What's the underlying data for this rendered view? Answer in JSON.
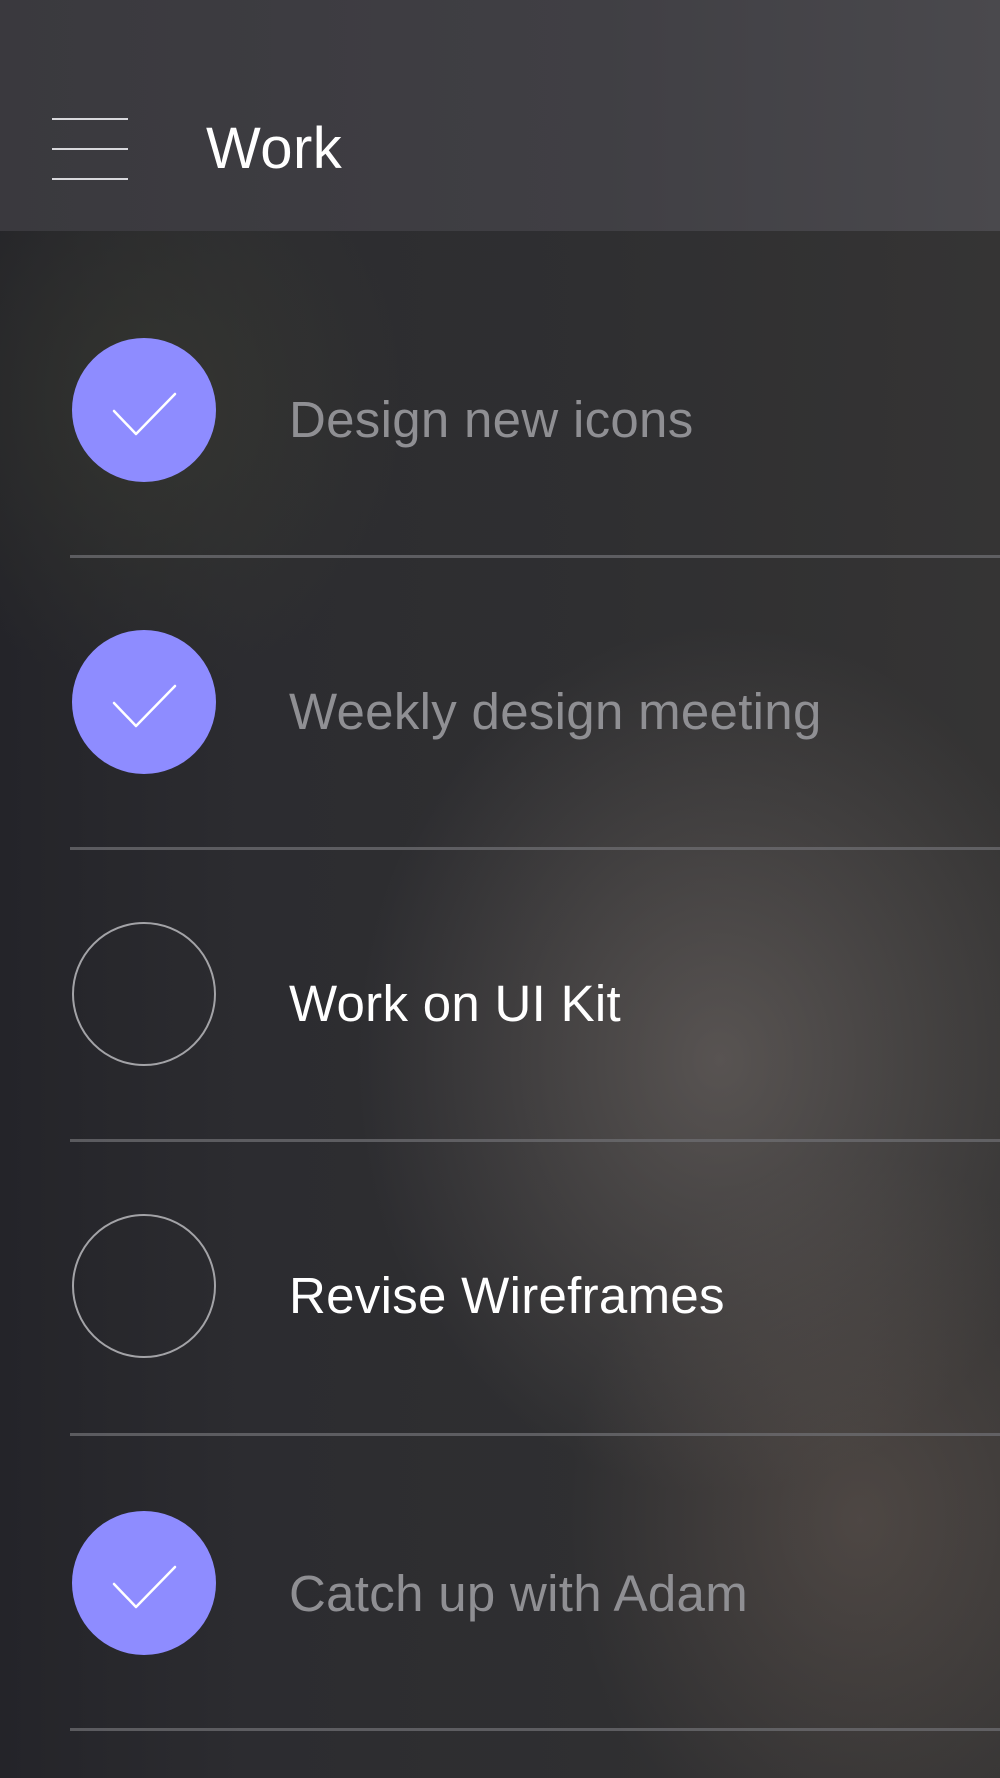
{
  "header": {
    "title": "Work",
    "menu_icon": "hamburger-menu-icon"
  },
  "colors": {
    "accent": "#8e8cff",
    "done_text": "#8f8f93",
    "open_text": "#ffffff"
  },
  "tasks": [
    {
      "label": "Design new icons",
      "done": true
    },
    {
      "label": "Weekly design meeting",
      "done": true
    },
    {
      "label": "Work on UI Kit",
      "done": false
    },
    {
      "label": "Revise Wireframes",
      "done": false
    },
    {
      "label": "Catch up with Adam",
      "done": true
    }
  ]
}
